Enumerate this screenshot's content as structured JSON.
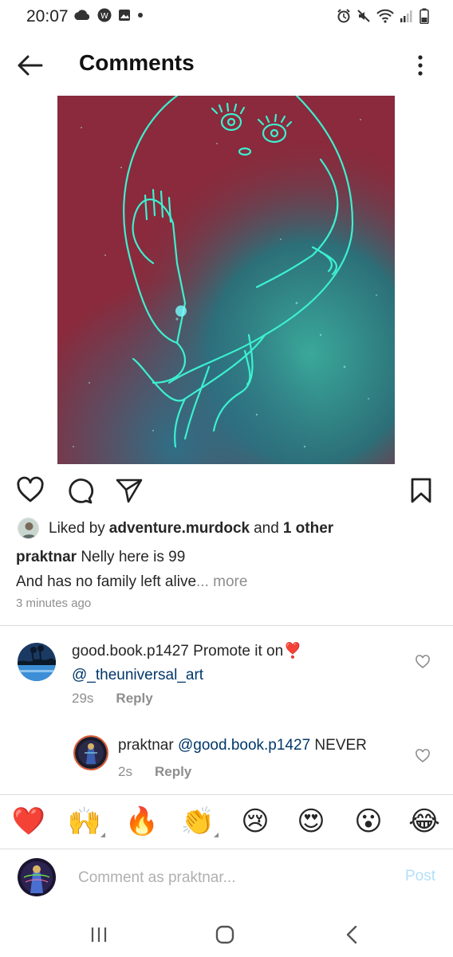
{
  "status_bar": {
    "time": "20:07",
    "left_icons": [
      "cloud-icon",
      "w-app-icon",
      "gallery-icon",
      "dot-icon"
    ],
    "right_icons": [
      "alarm-icon",
      "mute-icon",
      "wifi-icon",
      "signal-icon",
      "battery-icon"
    ]
  },
  "header": {
    "title": "Comments",
    "back_icon": "arrow-left-icon",
    "menu_icon": "more-vertical-icon"
  },
  "post": {
    "image_alt": "Cyan line drawing of a figure over a red and teal starry sky",
    "likes": {
      "prefix": "Liked by ",
      "user": "adventure.murdock",
      "middle": " and ",
      "others": "1 other"
    },
    "caption": {
      "username": "praktnar",
      "line1": "Nelly here is 99",
      "line2": "And has no family left alive",
      "more": "... more"
    },
    "time_ago": "3 minutes ago"
  },
  "comments": [
    {
      "username": "good.book.p1427",
      "text": "Promote it on",
      "emoji": "❣️",
      "mention": "@_theuniversal_art",
      "time": "29s",
      "reply_label": "Reply"
    },
    {
      "username": "praktnar",
      "mention": "@good.book.p1427",
      "text": "NEVER",
      "time": "2s",
      "reply_label": "Reply"
    }
  ],
  "emoji_bar": [
    "❤️",
    "🙌",
    "🔥",
    "👏",
    "😢",
    "😍",
    "😮",
    "😂"
  ],
  "composer": {
    "placeholder": "Comment as praktnar...",
    "post_label": "Post"
  },
  "colors": {
    "mention": "#00376b",
    "muted": "#8e8e8e",
    "post_disabled": "#b2dffc",
    "image_red": "#8a2a3c",
    "image_teal": "#2fe6c8"
  }
}
